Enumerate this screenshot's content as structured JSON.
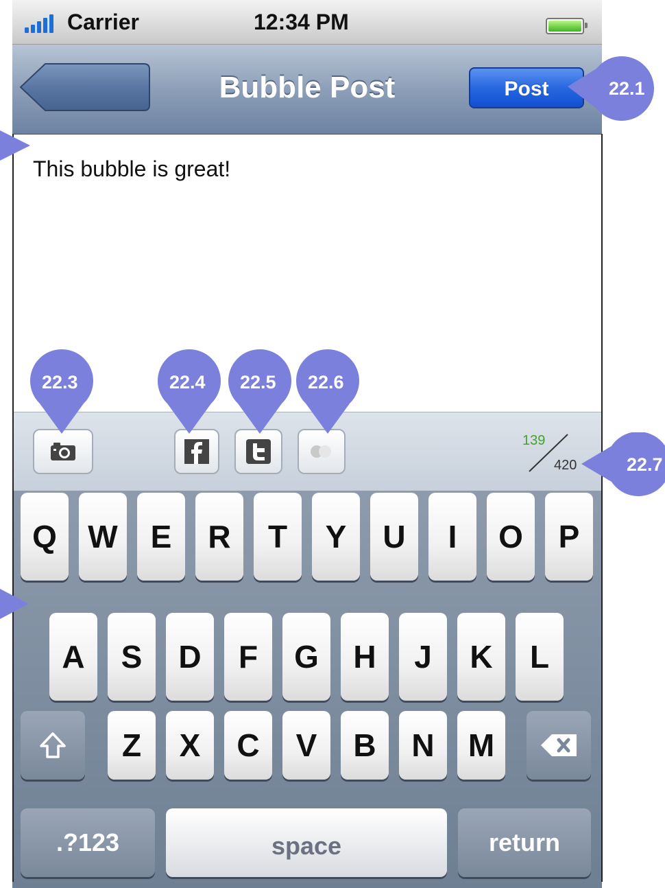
{
  "status_bar": {
    "carrier": "Carrier",
    "time": "12:34 PM"
  },
  "nav_bar": {
    "title": "Bubble Post",
    "post_label": "Post"
  },
  "composer": {
    "text": "This bubble is great!"
  },
  "accessory": {
    "icons": [
      "camera-icon",
      "facebook-icon",
      "twitter-icon",
      "toggle-icon"
    ],
    "counter_used": "139",
    "counter_total": "420"
  },
  "keyboard": {
    "row1": [
      "Q",
      "W",
      "E",
      "R",
      "T",
      "Y",
      "U",
      "I",
      "O",
      "P"
    ],
    "row2": [
      "A",
      "S",
      "D",
      "F",
      "G",
      "H",
      "J",
      "K",
      "L"
    ],
    "row3": [
      "Z",
      "X",
      "C",
      "V",
      "B",
      "N",
      "M"
    ],
    "numbers_label": ".?123",
    "space_label": "space",
    "return_label": "return"
  },
  "callouts": {
    "post": "22.1",
    "camera": "22.3",
    "facebook": "22.4",
    "twitter": "22.5",
    "toggle": "22.6",
    "counter": "22.7"
  },
  "colors": {
    "callout": "#7b80dc",
    "post_button": "#2867e0",
    "counter_used": "#44a12b",
    "nav_bar": "#8d9fb8"
  }
}
